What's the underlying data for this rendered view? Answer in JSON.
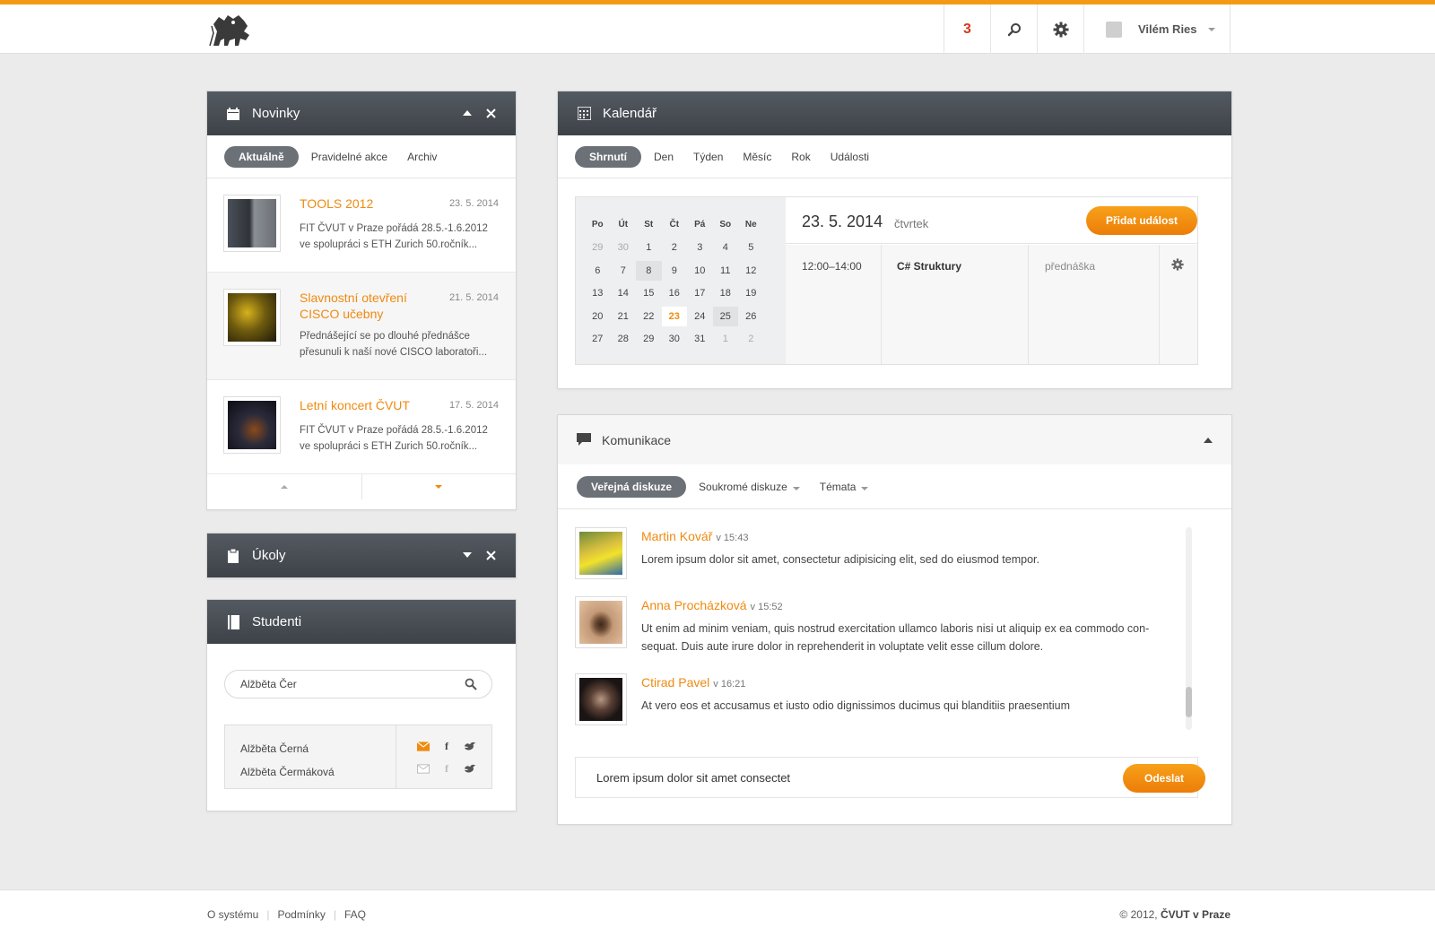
{
  "header": {
    "notifications": "3",
    "user_name": "Vilém Ries"
  },
  "news": {
    "title": "Novinky",
    "tabs": [
      "Aktuálně",
      "Pravidelné akce",
      "Archiv"
    ],
    "items": [
      {
        "title": "TOOLS 2012",
        "date": "23. 5. 2014",
        "text": "FIT ČVUT v Praze pořádá 28.5.-1.6.2012 ve spolupráci s ETH Zurich 50.ročník..."
      },
      {
        "title": "Slavnostní otevření CISCO učebny",
        "date": "21. 5. 2014",
        "text": "Přednášející se po dlouhé přednášce přesunuli k naší nové CISCO laboratoři..."
      },
      {
        "title": "Letní koncert ČVUT",
        "date": "17. 5. 2014",
        "text": "FIT ČVUT v Praze pořádá 28.5.-1.6.2012 ve spolupráci s ETH Zurich 50.ročník..."
      }
    ]
  },
  "tasks": {
    "title": "Úkoly"
  },
  "students": {
    "title": "Studenti",
    "search_value": "Alžběta Čer",
    "results": [
      "Alžběta Černá",
      "Alžběta Čermáková"
    ]
  },
  "calendar": {
    "title": "Kalendář",
    "tabs": [
      "Shrnutí",
      "Den",
      "Týden",
      "Měsíc",
      "Rok",
      "Události"
    ],
    "weekdays": [
      "Po",
      "Út",
      "St",
      "Čt",
      "Pá",
      "So",
      "Ne"
    ],
    "weeks": [
      [
        "29",
        "30",
        "1",
        "2",
        "3",
        "4",
        "5"
      ],
      [
        "6",
        "7",
        "8",
        "9",
        "10",
        "11",
        "12"
      ],
      [
        "13",
        "14",
        "15",
        "16",
        "17",
        "18",
        "19"
      ],
      [
        "20",
        "21",
        "22",
        "23",
        "24",
        "25",
        "26"
      ],
      [
        "27",
        "28",
        "29",
        "30",
        "31",
        "1",
        "2"
      ]
    ],
    "selected_date": "23. 5. 2014",
    "selected_weekday": "čtvrtek",
    "add_event_label": "Přidat událost",
    "event": {
      "time": "12:00–14:00",
      "name": "C# Struktury",
      "type": "přednáška"
    }
  },
  "communication": {
    "title": "Komunikace",
    "tabs": [
      "Veřejná diskuze",
      "Soukromé diskuze",
      "Témata"
    ],
    "messages": [
      {
        "author": "Martin Kovář",
        "time": "v 15:43",
        "text": "Lorem ipsum dolor sit amet, consectetur adipisicing elit, sed do eiusmod tempor."
      },
      {
        "author": "Anna Procházková",
        "time": "v 15:52",
        "text": "Ut enim ad minim veniam, quis nostrud exercitation ullamco laboris nisi ut aliquip ex ea commodo con-sequat. Duis aute irure dolor in reprehenderit in voluptate velit esse cillum dolore."
      },
      {
        "author": "Ctirad Pavel",
        "time": "v 16:21",
        "text": "At vero eos et accusamus et iusto odio dignissimos ducimus qui blanditiis praesentium"
      }
    ],
    "reply_value": "Lorem ipsum dolor sit amet consectet",
    "send_label": "Odeslat"
  },
  "footer": {
    "links": [
      "O systému",
      "Podmínky",
      "FAQ"
    ],
    "copyright_prefix": "© 2012, ",
    "copyright_org": "ČVUT v Praze"
  },
  "colors": {
    "accent": "#f39a14",
    "panel_header": "#43484e",
    "link": "#f08a10",
    "alert": "#d7371f"
  }
}
